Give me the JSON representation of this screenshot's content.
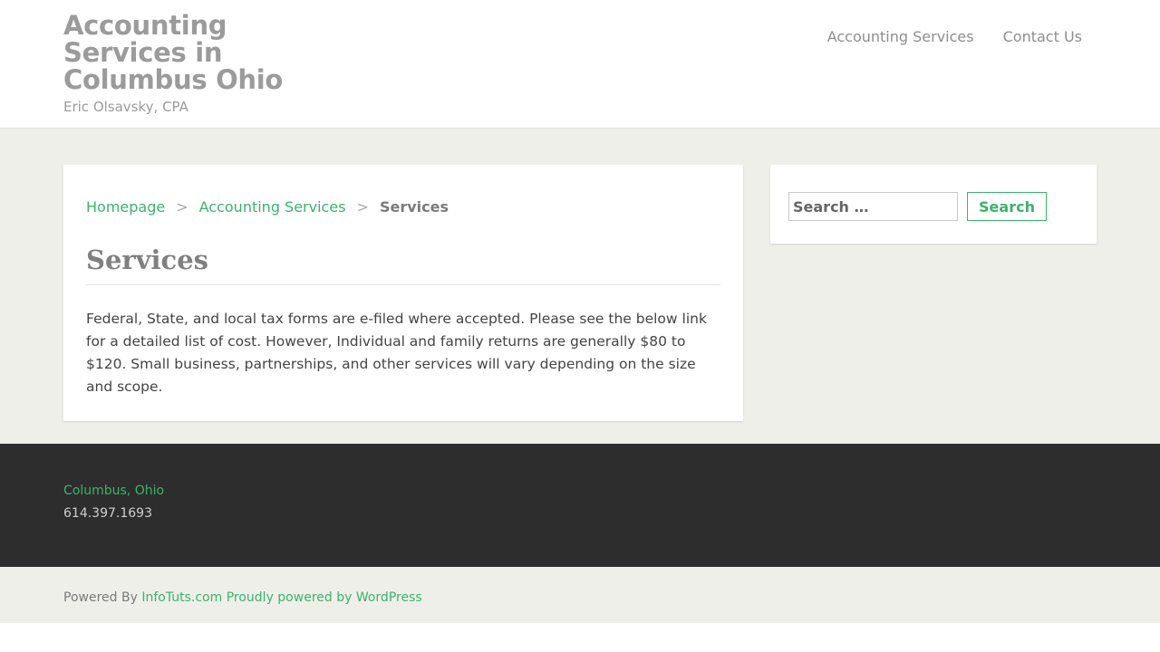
{
  "site": {
    "title": "Accounting Services in Columbus Ohio",
    "tagline": "Eric Olsavsky, CPA"
  },
  "nav": {
    "items": [
      {
        "label": "Accounting Services"
      },
      {
        "label": "Contact Us"
      }
    ]
  },
  "breadcrumb": {
    "home": "Homepage",
    "parent": "Accounting Services",
    "separator": ">",
    "current": "Services"
  },
  "page": {
    "title": "Services",
    "body": "Federal, State, and local tax forms are e-filed where accepted. Please see the below link for a detailed list of cost. However, Individual and family returns are generally $80 to $120. Small business, partnerships, and other services will vary depending on the size and scope."
  },
  "search": {
    "placeholder": "Search …",
    "button_label": "Search"
  },
  "footer": {
    "city": "Columbus, Ohio",
    "phone": "614.397.1693"
  },
  "bottom": {
    "powered_prefix": "Powered By ",
    "infotuts": "InfoTuts.com",
    "wordpress": "Proudly powered by WordPress"
  },
  "colors": {
    "accent": "#3bb36b",
    "page_bg": "#efefea",
    "footer_bg": "#2d2d2d",
    "title_gray": "#9b9b9b"
  }
}
